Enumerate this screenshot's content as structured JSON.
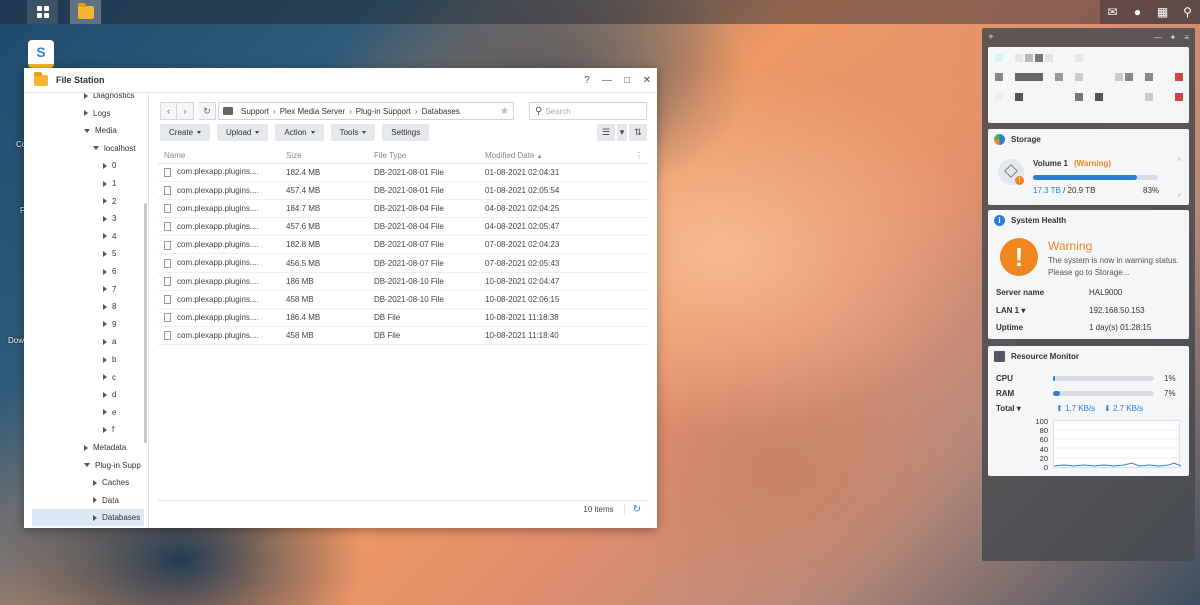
{
  "taskbar": {
    "main_menu_icon": "grid-icon",
    "file_station_icon": "folder-icon",
    "right_icons": [
      "chat-icon",
      "user-icon",
      "widgets-icon",
      "search-icon"
    ]
  },
  "desktop": {
    "partial_labels": [
      "Co",
      "F",
      "Dow"
    ]
  },
  "window": {
    "title": "File Station",
    "controls": [
      "?",
      "—",
      "□",
      "✕"
    ]
  },
  "tree": [
    {
      "label": "Diagnostics",
      "level": 2,
      "expander": "right"
    },
    {
      "label": "Logs",
      "level": 2,
      "expander": "right"
    },
    {
      "label": "Media",
      "level": 2,
      "expander": "down"
    },
    {
      "label": "localhost",
      "level": 3,
      "expander": "down"
    },
    {
      "label": "0",
      "level": 4,
      "expander": "right"
    },
    {
      "label": "1",
      "level": 4,
      "expander": "right"
    },
    {
      "label": "2",
      "level": 4,
      "expander": "right"
    },
    {
      "label": "3",
      "level": 4,
      "expander": "right"
    },
    {
      "label": "4",
      "level": 4,
      "expander": "right"
    },
    {
      "label": "5",
      "level": 4,
      "expander": "right"
    },
    {
      "label": "6",
      "level": 4,
      "expander": "right"
    },
    {
      "label": "7",
      "level": 4,
      "expander": "right"
    },
    {
      "label": "8",
      "level": 4,
      "expander": "right"
    },
    {
      "label": "9",
      "level": 4,
      "expander": "right"
    },
    {
      "label": "a",
      "level": 4,
      "expander": "right"
    },
    {
      "label": "b",
      "level": 4,
      "expander": "right"
    },
    {
      "label": "c",
      "level": 4,
      "expander": "right"
    },
    {
      "label": "d",
      "level": 4,
      "expander": "right"
    },
    {
      "label": "e",
      "level": 4,
      "expander": "right"
    },
    {
      "label": "f",
      "level": 4,
      "expander": "right"
    },
    {
      "label": "Metadata",
      "level": 2,
      "expander": "right"
    },
    {
      "label": "Plug-in Supp",
      "level": 2,
      "expander": "down"
    },
    {
      "label": "Caches",
      "level": 3,
      "expander": "right"
    },
    {
      "label": "Data",
      "level": 3,
      "expander": "right"
    },
    {
      "label": "Databases",
      "level": 3,
      "expander": "right",
      "selected": true
    }
  ],
  "path": {
    "crumbs": [
      "Support",
      "Plug-in Support",
      "Databases"
    ],
    "crumb_server": "Plex Media Server",
    "search_placeholder": "Search"
  },
  "toolbar": {
    "create": "Create",
    "upload": "Upload",
    "action": "Action",
    "tools": "Tools",
    "settings": "Settings"
  },
  "table": {
    "columns": [
      "Name",
      "Size",
      "File Type",
      "Modified Date"
    ],
    "rows": [
      [
        "com.plexapp.plugins....",
        "182.4 MB",
        "DB-2021-08-01 File",
        "01-08-2021 02:04:31"
      ],
      [
        "com.plexapp.plugins....",
        "457.4 MB",
        "DB-2021-08-01 File",
        "01-08-2021 02:05:54"
      ],
      [
        "com.plexapp.plugins....",
        "184.7 MB",
        "DB-2021-08-04 File",
        "04-08-2021 02:04:25"
      ],
      [
        "com.plexapp.plugins....",
        "457.6 MB",
        "DB-2021-08-04 File",
        "04-08-2021 02:05:47"
      ],
      [
        "com.plexapp.plugins....",
        "182.8 MB",
        "DB-2021-08-07 File",
        "07-08-2021 02:04:23"
      ],
      [
        "com.plexapp.plugins....",
        "456.5 MB",
        "DB-2021-08-07 File",
        "07-08-2021 02:05:43"
      ],
      [
        "com.plexapp.plugins....",
        "186 MB",
        "DB-2021-08-10 File",
        "10-08-2021 02:04:47"
      ],
      [
        "com.plexapp.plugins....",
        "458 MB",
        "DB-2021-08-10 File",
        "10-08-2021 02:06:15"
      ],
      [
        "com.plexapp.plugins....",
        "186.4 MB",
        "DB File",
        "10-08-2021 11:18:38"
      ],
      [
        "com.plexapp.plugins....",
        "458 MB",
        "DB File",
        "10-08-2021 11:18:40"
      ]
    ],
    "item_count": "10 items"
  },
  "storage": {
    "title": "Storage",
    "volume": "Volume 1",
    "status": "Warning",
    "used": "17.3 TB",
    "total": "20.9 TB",
    "percent": "83%",
    "fill_fraction": 0.83
  },
  "health": {
    "title": "System Health",
    "status": "Warning",
    "message": "The system is now in warning status. Please go to Storage...",
    "server_name_label": "Server name",
    "server_name": "HAL9000",
    "lan_label": "LAN 1",
    "lan_ip": "192.168.50.153",
    "uptime_label": "Uptime",
    "uptime": "1 day(s) 01:28:15"
  },
  "resource": {
    "title": "Resource Monitor",
    "cpu_label": "CPU",
    "cpu": "1%",
    "cpu_fraction": 0.01,
    "ram_label": "RAM",
    "ram": "7%",
    "ram_fraction": 0.07,
    "total_label": "Total",
    "up": "1.7 KB/s",
    "down": "2.7 KB/s",
    "y_ticks": [
      "100",
      "80",
      "60",
      "40",
      "20",
      "0"
    ]
  }
}
